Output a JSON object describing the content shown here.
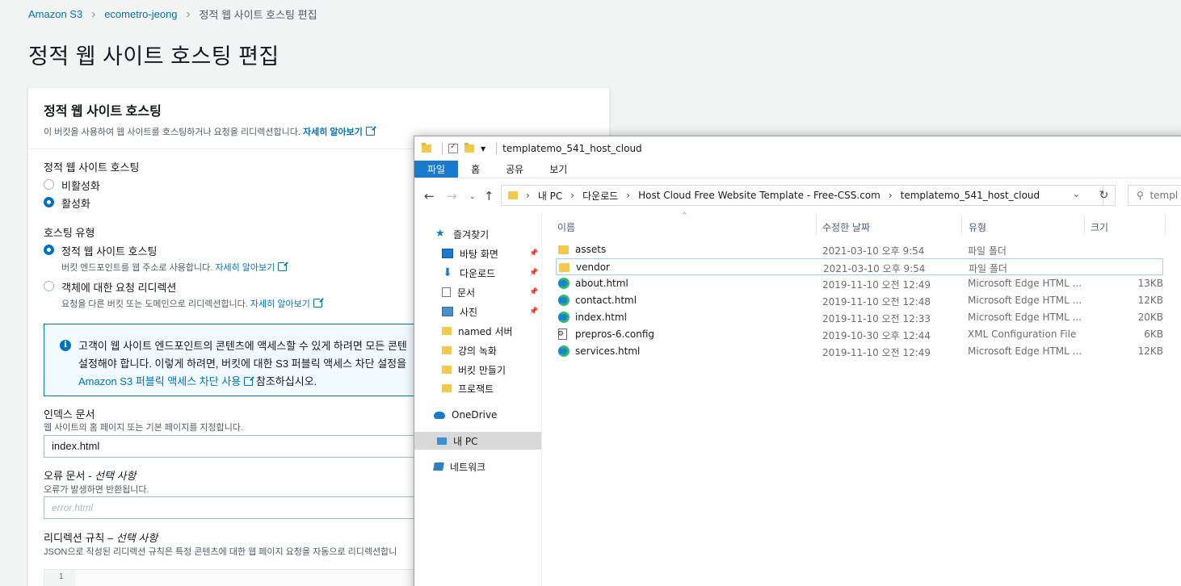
{
  "aws": {
    "breadcrumb": [
      "Amazon S3",
      "ecometro-jeong",
      "정적 웹 사이트 호스팅 편집"
    ],
    "page_title": "정적 웹 사이트 호스팅 편집",
    "panel": {
      "title": "정적 웹 사이트 호스팅",
      "description": "이 버킷을 사용하여 웹 사이트를 호스팅하거나 요청을 리디렉션합니다.",
      "learn_more": "자세히 알아보기"
    },
    "hosting_label": "정적 웹 사이트 호스팅",
    "hosting_options": [
      "비활성화",
      "활성화"
    ],
    "hosting_selected": "활성화",
    "type_label": "호스팅 유형",
    "type_static": "정적 웹 사이트 호스팅",
    "type_static_desc": "버킷 엔드포인트를 웹 주소로 사용합니다.",
    "type_redirect": "객체에 대한 요청 리디렉션",
    "type_redirect_desc": "요청을 다른 버킷 또는 도메인으로 리디렉션합니다.",
    "learn_more": "자세히 알아보기",
    "info_line1": "고객이 웹 사이트 엔드포인트의 콘텐츠에 액세스할 수 있게 하려면 모든 콘텐",
    "info_line2": "설정해야 합니다. 이렇게 하려면, 버킷에 대한 S3 퍼블릭 액세스 차단 설정을",
    "info_link": "Amazon S3 퍼블릭 액세스 차단 사용",
    "info_tail": "참조하십시오.",
    "index_label": "인덱스 문서",
    "index_desc": "웹 사이트의 홈 페이지 또는 기본 페이지를 지정합니다.",
    "index_value": "index.html",
    "error_label": "오류 문서 - ",
    "error_optional": "선택 사항",
    "error_desc": "오류가 발생하면 반환됩니다.",
    "error_placeholder": "error.html",
    "redirect_label": "리디렉션 규칙 – ",
    "redirect_optional": "선택 사항",
    "redirect_desc": "JSON으로 작성된 리디렉션 규칙은 특정 콘텐츠에 대한 웹 페이지 요청을 자동으로 리디렉션합니",
    "code_line": "1"
  },
  "explorer": {
    "title": "templatemo_541_host_cloud",
    "ribbon_tabs": [
      "파일",
      "홈",
      "공유",
      "보기"
    ],
    "path": [
      "내 PC",
      "다운로드",
      "Host Cloud Free Website Template - Free-CSS.com",
      "templatemo_541_host_cloud"
    ],
    "search_placeholder": "templ",
    "nav": {
      "quick_access": "즐겨찾기",
      "items": [
        "바탕 화면",
        "다운로드",
        "문서",
        "사진",
        "named 서버",
        "강의 녹화",
        "버킷 만들기",
        "프로잭트"
      ],
      "onedrive": "OneDrive",
      "this_pc": "내 PC",
      "network": "네트워크"
    },
    "columns": [
      "이름",
      "수정한 날짜",
      "유형",
      "크기"
    ],
    "files": [
      {
        "name": "assets",
        "date": "2021-03-10 오후 9:54",
        "type": "파일 폴더",
        "size": "",
        "icon": "folder-icon"
      },
      {
        "name": "vendor",
        "date": "2021-03-10 오후 9:54",
        "type": "파일 폴더",
        "size": "",
        "icon": "folder-icon"
      },
      {
        "name": "about.html",
        "date": "2019-11-10 오전 12:49",
        "type": "Microsoft Edge HTML ...",
        "size": "13KB",
        "icon": "edge-icon"
      },
      {
        "name": "contact.html",
        "date": "2019-11-10 오전 12:48",
        "type": "Microsoft Edge HTML ...",
        "size": "12KB",
        "icon": "edge-icon"
      },
      {
        "name": "index.html",
        "date": "2019-11-10 오전 12:33",
        "type": "Microsoft Edge HTML ...",
        "size": "20KB",
        "icon": "edge-icon"
      },
      {
        "name": "prepros-6.config",
        "date": "2019-10-30 오후 12:44",
        "type": "XML Configuration File",
        "size": "6KB",
        "icon": "config-file-icon"
      },
      {
        "name": "services.html",
        "date": "2019-11-10 오전 12:49",
        "type": "Microsoft Edge HTML ...",
        "size": "12KB",
        "icon": "edge-icon"
      }
    ]
  }
}
